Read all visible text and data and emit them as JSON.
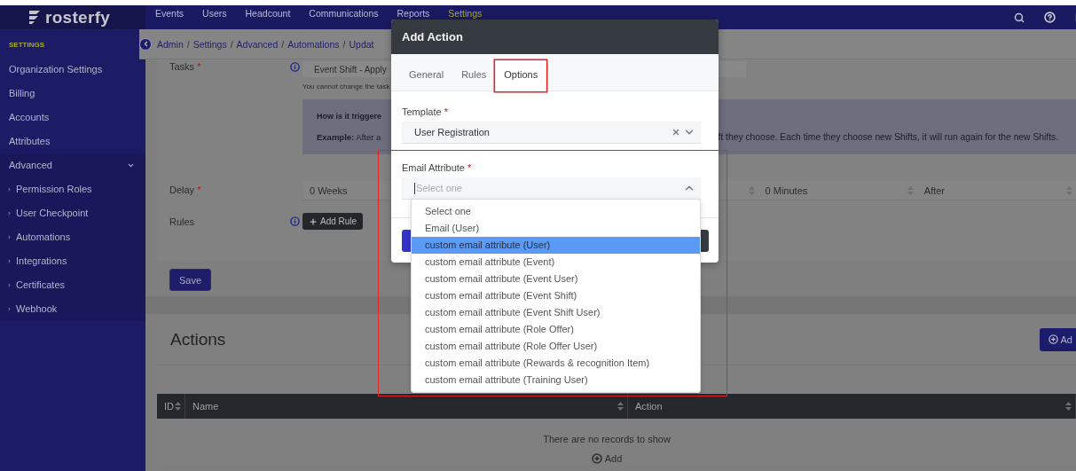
{
  "topbar": {
    "logo": "rosterfy",
    "nav": [
      {
        "label": "Events",
        "selected": false
      },
      {
        "label": "Users",
        "selected": false
      },
      {
        "label": "Headcount",
        "selected": false
      },
      {
        "label": "Communications",
        "selected": false
      },
      {
        "label": "Reports",
        "selected": false
      },
      {
        "label": "Settings",
        "selected": true
      }
    ]
  },
  "sidebar": {
    "heading": "SETTINGS",
    "items": [
      {
        "label": "Organization Settings"
      },
      {
        "label": "Billing"
      },
      {
        "label": "Accounts"
      },
      {
        "label": "Attributes"
      },
      {
        "label": "Advanced",
        "expanded": true,
        "children": [
          {
            "label": "Permission Roles"
          },
          {
            "label": "User Checkpoint"
          },
          {
            "label": "Automations"
          },
          {
            "label": "Integrations"
          },
          {
            "label": "Certificates"
          },
          {
            "label": "Webhook"
          }
        ]
      }
    ]
  },
  "breadcrumb": {
    "separator": "/",
    "items": [
      "Admin",
      "Settings",
      "Advanced",
      "Automations",
      "Updat"
    ]
  },
  "form": {
    "tasks": {
      "label": "Tasks",
      "required_mark": "*",
      "value": "Event Shift - Apply",
      "hint": "You cannot change the task"
    },
    "info": {
      "title": "How is it triggere",
      "example": "**Example:** After a",
      "continuation": "ft they choose. Each time they choose new Shifts, it will run again for the new Shifts."
    },
    "delay": {
      "label": "Delay",
      "required_mark": "*",
      "selects": [
        "0 Weeks",
        "0 Minutes",
        "After"
      ]
    },
    "rules": {
      "label": "Rules",
      "button": "Add Rule"
    },
    "save": "Save"
  },
  "actions": {
    "title": "Actions",
    "add_button": "Ad",
    "columns": [
      "ID",
      "Name",
      "Action"
    ],
    "empty": "There are no records to show",
    "add_link": "Add"
  },
  "modal": {
    "title": "Add Action",
    "tabs": [
      {
        "label": "General",
        "selected": false,
        "highlighted": false
      },
      {
        "label": "Rules",
        "selected": false,
        "highlighted": false
      },
      {
        "label": "Options",
        "selected": true,
        "highlighted": true
      }
    ],
    "template": {
      "label": "Template",
      "required_mark": "*",
      "value": "User Registration"
    },
    "email_attribute": {
      "label": "Email Attribute",
      "required_mark": "*",
      "placeholder": "Select one",
      "open": true,
      "highlighted": true,
      "options": [
        {
          "label": "Select one",
          "selected": false
        },
        {
          "label": "Email (User)",
          "selected": false
        },
        {
          "label": "custom email attribute (User)",
          "selected": true
        },
        {
          "label": "custom email attribute (Event)",
          "selected": false
        },
        {
          "label": "custom email attribute (Event User)",
          "selected": false
        },
        {
          "label": "custom email attribute (Event Shift)",
          "selected": false
        },
        {
          "label": "custom email attribute (Event Shift User)",
          "selected": false
        },
        {
          "label": "custom email attribute (Role Offer)",
          "selected": false
        },
        {
          "label": "custom email attribute (Role Offer User)",
          "selected": false
        },
        {
          "label": "custom email attribute (Rewards & recognition Item)",
          "selected": false
        },
        {
          "label": "custom email attribute (Training User)",
          "selected": false
        }
      ]
    }
  }
}
